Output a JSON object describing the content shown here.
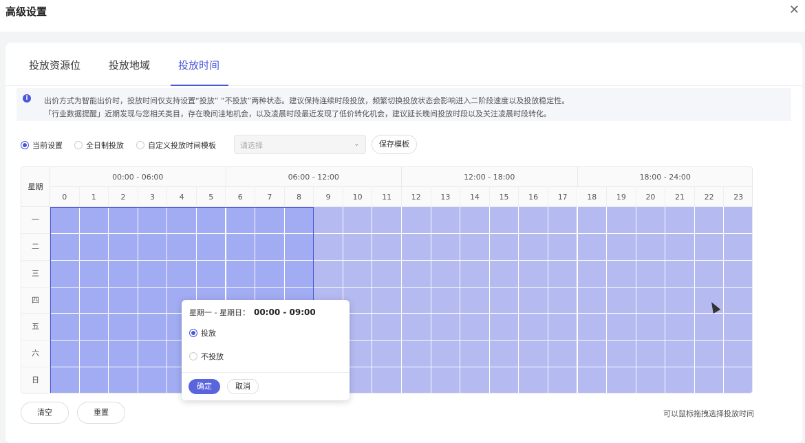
{
  "dialog": {
    "title": "高级设置",
    "close_icon": "close-icon"
  },
  "tabs": [
    {
      "label": "投放资源位",
      "active": false
    },
    {
      "label": "投放地域",
      "active": false
    },
    {
      "label": "投放时间",
      "active": true
    }
  ],
  "notice": {
    "icon": "info-icon",
    "line1": "出价方式为智能出价时，投放时间仅支持设置“投放” “不投放”两种状态。建议保持连续时段投放，频繁切换投放状态会影响进入二阶段速度以及投放稳定性。",
    "line2": "「行业数据提醒」近期发现与您相关类目，存在晚间洼地机会，以及凌晨时段最近发现了低价转化机会，建议延长晚间投放时段以及关注凌晨时段转化。"
  },
  "options": {
    "current_label": "当前设置",
    "allday_label": "全日制投放",
    "custom_label": "自定义投放时间模板",
    "select_placeholder": "请选择",
    "save_template_label": "保存模板"
  },
  "grid": {
    "corner_label": "星期",
    "groups": [
      "00:00 - 06:00",
      "06:00 - 12:00",
      "12:00 - 18:00",
      "18:00 - 24:00"
    ],
    "hours": [
      "0",
      "1",
      "2",
      "3",
      "4",
      "5",
      "6",
      "7",
      "8",
      "9",
      "10",
      "11",
      "12",
      "13",
      "14",
      "15",
      "16",
      "17",
      "18",
      "19",
      "20",
      "21",
      "22",
      "23"
    ],
    "days": [
      "一",
      "二",
      "三",
      "四",
      "五",
      "六",
      "日"
    ],
    "selected_hours": 9
  },
  "footer": {
    "clear_label": "清空",
    "reset_label": "重置",
    "hint": "可以鼠标拖拽选择投放时间"
  },
  "popover": {
    "range_label": "星期一 - 星期日：",
    "range_value": "00:00 - 09:00",
    "option_on": "投放",
    "option_off": "不投放",
    "ok_label": "确定",
    "cancel_label": "取消"
  },
  "colors": {
    "accent": "#4a57d9",
    "cell": "#b5baf0",
    "cell_selected": "#a2acf2"
  }
}
